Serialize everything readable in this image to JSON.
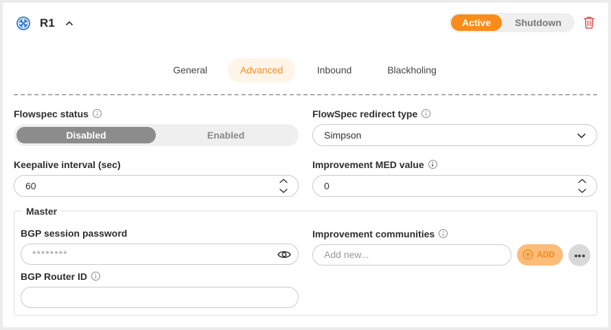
{
  "header": {
    "router_name": "R1",
    "router_icon": "network-node-icon",
    "collapse_icon": "chevron-up-icon",
    "state_active_label": "Active",
    "state_shutdown_label": "Shutdown",
    "selected_state": "Active",
    "delete_icon": "trash-icon"
  },
  "tabs": [
    {
      "label": "General"
    },
    {
      "label": "Advanced"
    },
    {
      "label": "Inbound"
    },
    {
      "label": "Blackholing"
    }
  ],
  "active_tab": "Advanced",
  "flowspec_status": {
    "label": "Flowspec status",
    "options": [
      "Disabled",
      "Enabled"
    ],
    "selected": "Disabled"
  },
  "flowspec_redirect": {
    "label": "FlowSpec redirect type",
    "value": "Simpson"
  },
  "keepalive": {
    "label": "Keepalive interval (sec)",
    "value": "60"
  },
  "improvement_med": {
    "label": "Improvement MED value",
    "value": "0"
  },
  "master": {
    "legend": "Master",
    "bgp_password": {
      "label": "BGP session password",
      "value": "********",
      "icon": "eye-icon"
    },
    "bgp_router_id": {
      "label": "BGP Router ID",
      "value": ""
    },
    "improvement_communities": {
      "label": "Improvement communities",
      "placeholder": "Add new...",
      "add_label": "ADD",
      "add_icon": "plus-circle-icon",
      "more_icon": "more-horizontal-icon"
    }
  },
  "colors": {
    "accent": "#f98c1b",
    "accent_light": "#fdbc78",
    "accent_tab_bg": "#fef4e8",
    "danger": "#e05252",
    "router_icon": "#3d7fd1",
    "segment_selected": "#8c8c8c"
  }
}
